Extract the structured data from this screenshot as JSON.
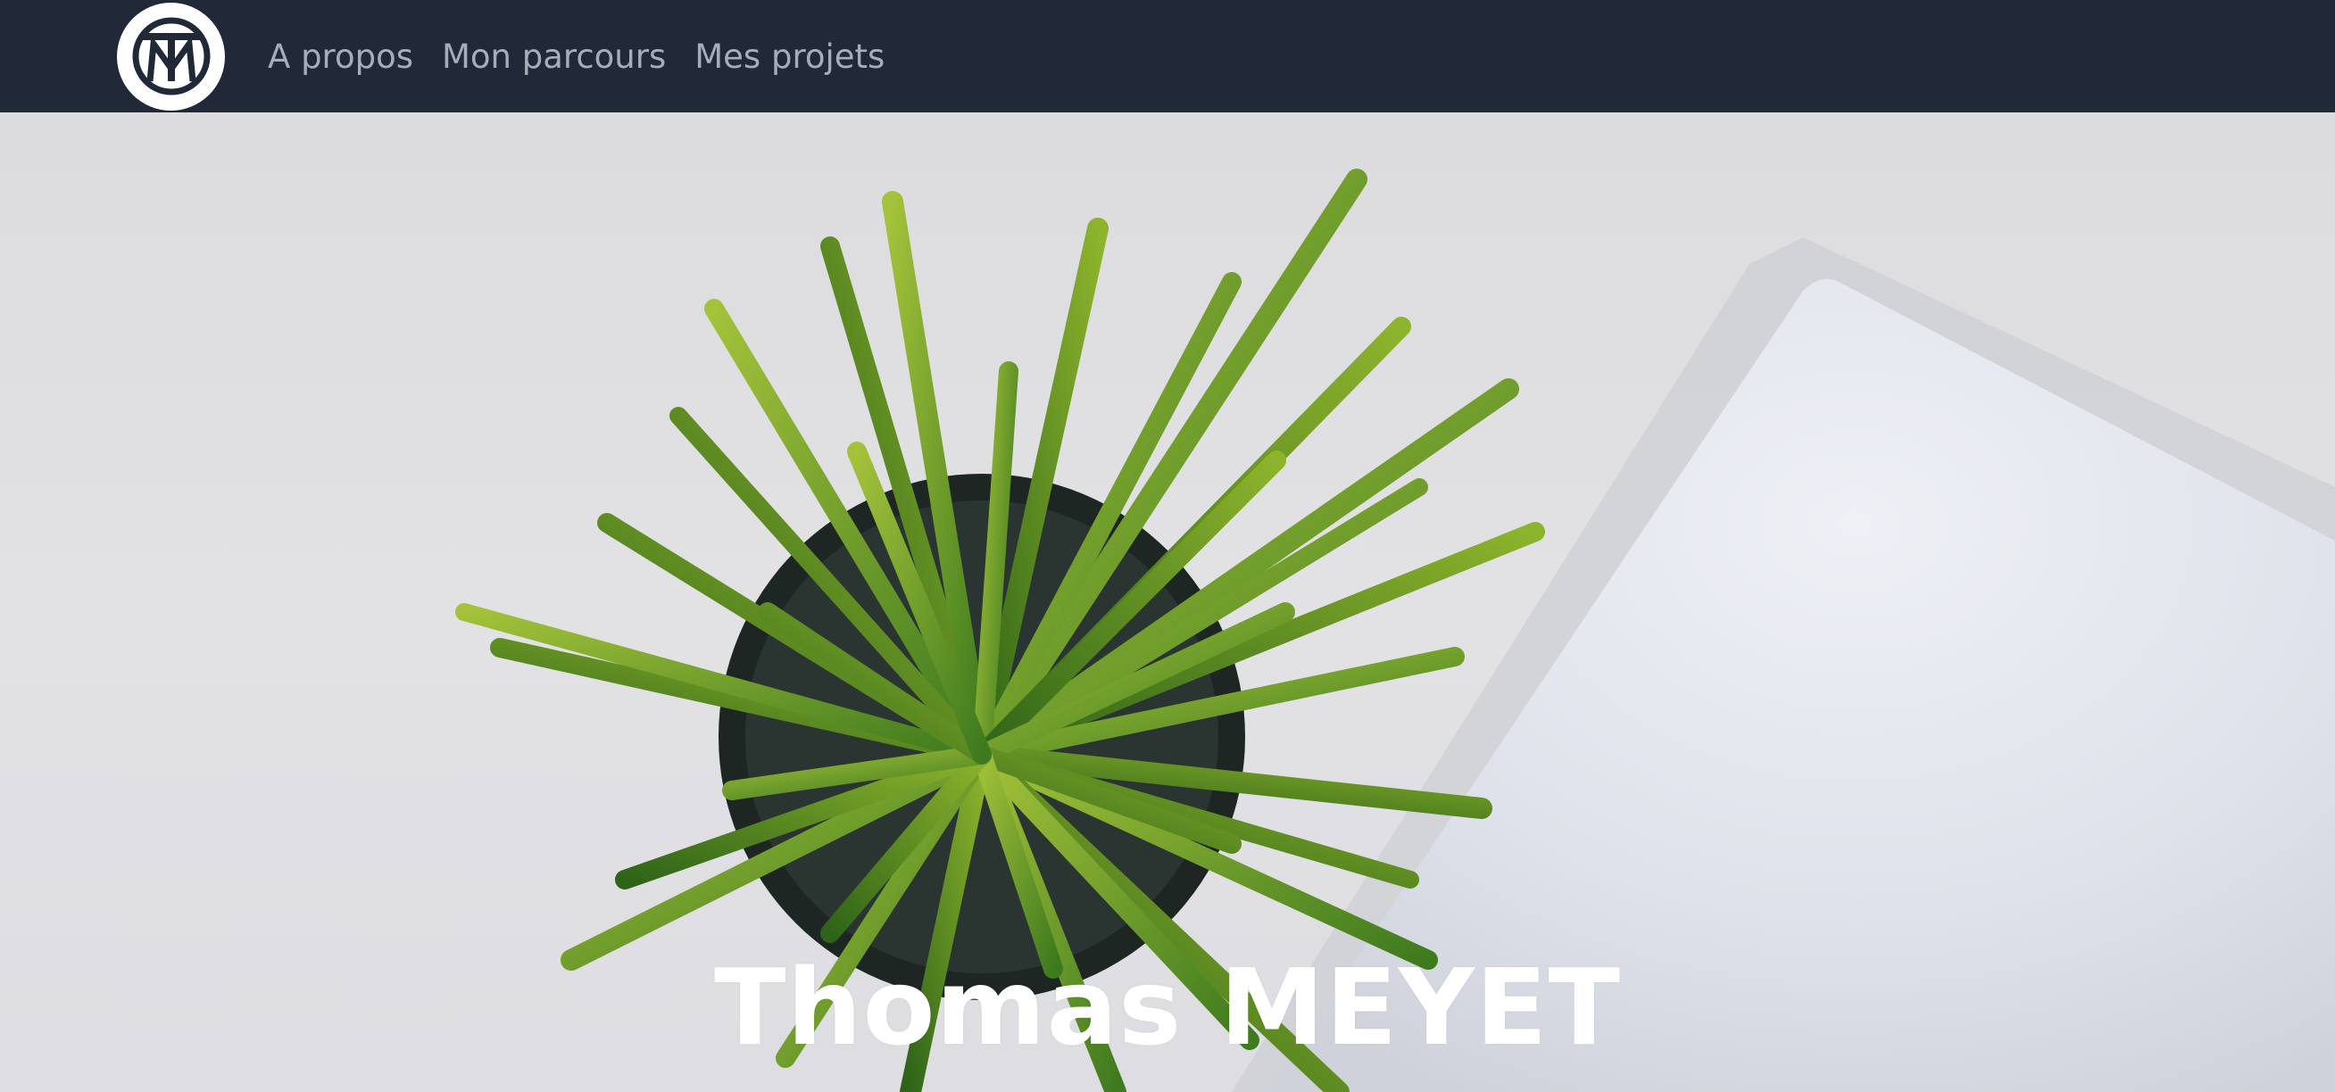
{
  "nav": {
    "logo_icon": "tm-monogram-logo",
    "links": [
      {
        "label": "A propos"
      },
      {
        "label": "Mon parcours"
      },
      {
        "label": "Mes projets"
      }
    ]
  },
  "hero": {
    "title": "Thomas MEYET",
    "image_icon": "plant-and-laptop-photo"
  },
  "colors": {
    "navbar_bg": "#212837",
    "nav_link": "#a7adb8",
    "hero_title": "#ffffff"
  }
}
